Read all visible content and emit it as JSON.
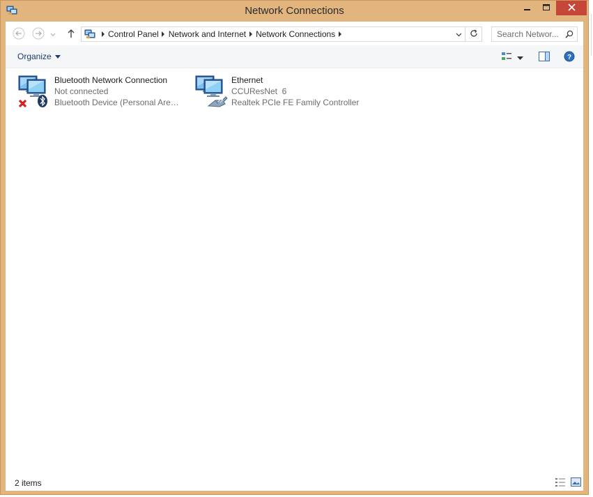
{
  "window": {
    "title": "Network Connections",
    "controls": {
      "minimize": "minimize-icon",
      "maximize": "maximize-icon",
      "close": "close-icon"
    },
    "accent": "#e2b57f",
    "close_color": "#c7463a"
  },
  "address": {
    "breadcrumbs": [
      "Control Panel",
      "Network and Internet",
      "Network Connections"
    ],
    "search_placeholder": "Search Networ..."
  },
  "toolbar": {
    "organize_label": "Organize"
  },
  "connections": [
    {
      "name": "Bluetooth Network Connection",
      "status": "Not connected",
      "device": "Bluetooth Device (Personal Area ...",
      "icon": "bluetooth-network-icon"
    },
    {
      "name": "Ethernet",
      "status": "CCUResNet  6",
      "device": "Realtek PCIe FE Family Controller",
      "icon": "ethernet-network-icon"
    }
  ],
  "statusbar": {
    "item_count": "2 items"
  }
}
